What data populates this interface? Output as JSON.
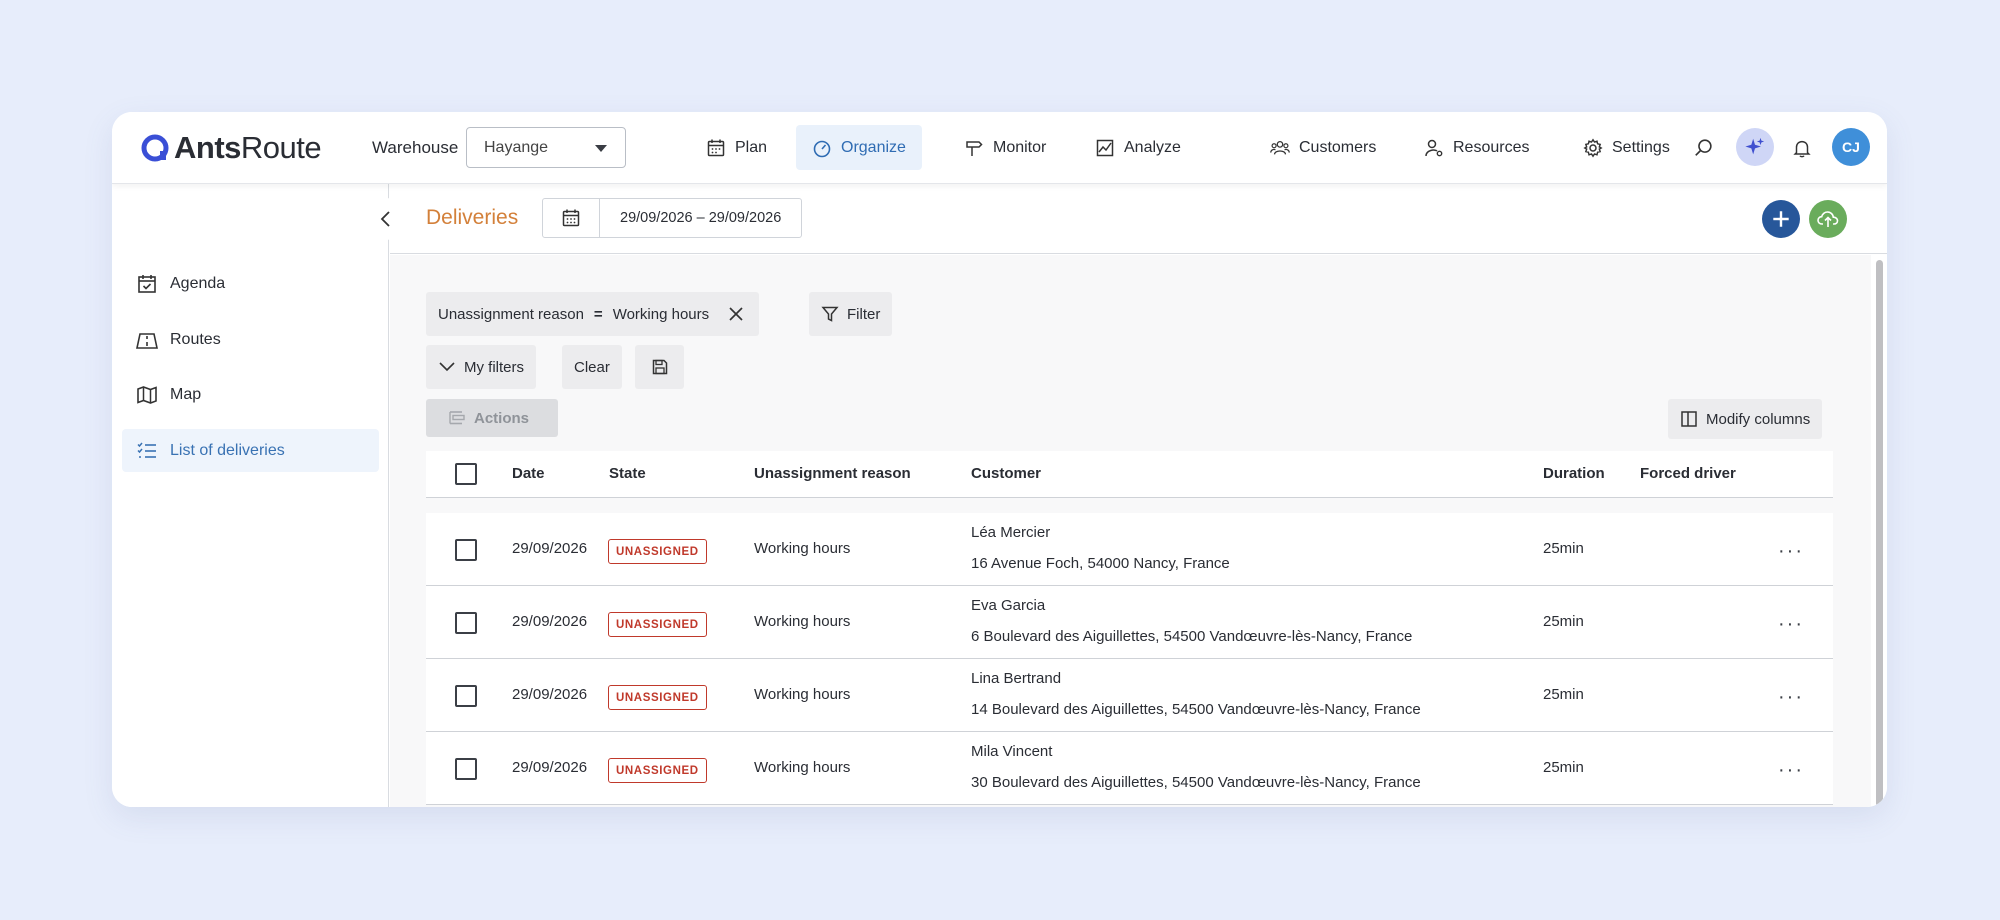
{
  "app": {
    "logo_word_bold": "Ants",
    "logo_word_light": "Route",
    "brand_color": "#3a4fd6"
  },
  "topbar": {
    "warehouse_label": "Warehouse",
    "warehouse_value": "Hayange",
    "nav": [
      {
        "label": "Plan",
        "icon": "calendar-icon"
      },
      {
        "label": "Organize",
        "icon": "gauge-icon",
        "active": true
      },
      {
        "label": "Monitor",
        "icon": "signpost-icon"
      },
      {
        "label": "Analyze",
        "icon": "chart-icon"
      }
    ],
    "right_nav": [
      {
        "label": "Customers",
        "icon": "users-icon"
      },
      {
        "label": "Resources",
        "icon": "user-gear-icon"
      },
      {
        "label": "Settings",
        "icon": "gear-icon"
      }
    ],
    "avatar_initials": "CJ"
  },
  "sidebar": {
    "items": [
      {
        "label": "Agenda",
        "icon": "calendar-check-icon"
      },
      {
        "label": "Routes",
        "icon": "road-icon"
      },
      {
        "label": "Map",
        "icon": "map-icon"
      },
      {
        "label": "List of deliveries",
        "icon": "list-icon",
        "active": true
      }
    ]
  },
  "header": {
    "title": "Deliveries",
    "date_range": "29/09/2026 – 29/09/2026"
  },
  "filters": {
    "chip_field": "Unassignment reason",
    "chip_operator": "=",
    "chip_value": "Working hours",
    "filter_label": "Filter",
    "my_filters_label": "My filters",
    "clear_label": "Clear",
    "actions_label": "Actions",
    "modify_columns_label": "Modify columns"
  },
  "table": {
    "columns": {
      "date": "Date",
      "state": "State",
      "reason": "Unassignment reason",
      "customer": "Customer",
      "duration": "Duration",
      "forced_driver": "Forced driver"
    },
    "rows": [
      {
        "date": "29/09/2026",
        "state": "UNASSIGNED",
        "reason": "Working hours",
        "customer": "Léa Mercier",
        "address": "16 Avenue Foch, 54000 Nancy, France",
        "duration": "25min",
        "more": "···"
      },
      {
        "date": "29/09/2026",
        "state": "UNASSIGNED",
        "reason": "Working hours",
        "customer": "Eva Garcia",
        "address": "6 Boulevard des Aiguillettes, 54500 Vandœuvre-lès-Nancy, France",
        "duration": "25min",
        "more": "···"
      },
      {
        "date": "29/09/2026",
        "state": "UNASSIGNED",
        "reason": "Working hours",
        "customer": "Lina Bertrand",
        "address": "14 Boulevard des Aiguillettes, 54500 Vandœuvre-lès-Nancy, France",
        "duration": "25min",
        "more": "···"
      },
      {
        "date": "29/09/2026",
        "state": "UNASSIGNED",
        "reason": "Working hours",
        "customer": "Mila Vincent",
        "address": "30 Boulevard des Aiguillettes, 54500 Vandœuvre-lès-Nancy, France",
        "duration": "25min",
        "more": "···"
      }
    ]
  },
  "colors": {
    "accent_orange": "#d3803a",
    "active_blue": "#2f6cb3",
    "badge_red": "#c0392b",
    "add_button": "#27579a",
    "cloud_button": "#6aac5c"
  }
}
